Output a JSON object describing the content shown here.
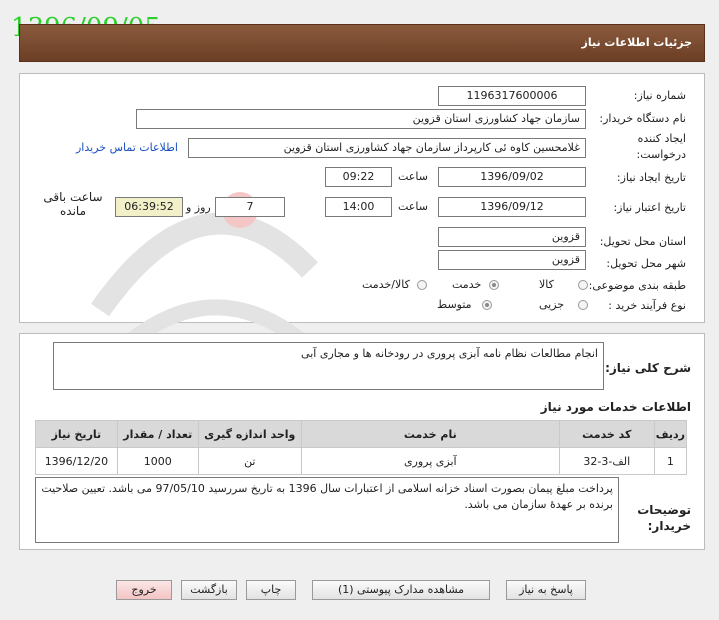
{
  "stamp_date": "1396/09/05",
  "title": "جزئیات اطلاعات نیاز",
  "form": {
    "need_number_label": "شماره نیاز:",
    "need_number": "1196317600006",
    "buyer_org_label": "نام دستگاه خریدار:",
    "buyer_org": "سازمان جهاد کشاورزی استان قزوین",
    "creator_label": "ایجاد کننده درخواست:",
    "creator": "غلامحسین کاوه ئی کارپرداز سازمان جهاد کشاورزی استان قزوین",
    "contact_link": "اطلاعات تماس خریدار",
    "created_date_label": "تاریخ ایجاد نیاز:",
    "created_date": "1396/09/02",
    "time_label": "ساعت",
    "created_time": "09:22",
    "valid_date_label": "تاریخ اعتبار نیاز:",
    "valid_date": "1396/09/12",
    "valid_time": "14:00",
    "days_value": "7",
    "days_label": "روز و",
    "remaining_time": "06:39:52",
    "remaining_label": "ساعت باقی مانده",
    "province_label": "استان محل تحویل:",
    "province": "قزوین",
    "city_label": "شهر محل تحویل:",
    "city": "قزوین",
    "category_label": "طبقه بندی موضوعی:",
    "category_options": [
      "کالا",
      "خدمت",
      "کالا/خدمت"
    ],
    "category_selected": "خدمت",
    "process_label": "نوع فرآیند خرید :",
    "process_options": [
      "جزیی",
      "متوسط"
    ],
    "process_selected": "متوسط"
  },
  "description": {
    "label": "شرح کلی نیاز:",
    "text": "انجام مطالعات نظام نامه آبزی پروری در رودخانه ها و مجاری آبی"
  },
  "services": {
    "heading": "اطلاعات خدمات مورد نیاز",
    "columns": [
      "ردیف",
      "کد خدمت",
      "نام خدمت",
      "واحد اندازه گیری",
      "تعداد / مقدار",
      "تاریخ نیاز"
    ],
    "rows": [
      [
        "1",
        "الف-3-32",
        "آبزی پروری",
        "تن",
        "1000",
        "1396/12/20"
      ]
    ]
  },
  "notes": {
    "label": "توضیحات خریدار:",
    "text": "پرداخت مبلغ پیمان بصورت اسناد خزانه اسلامی از اعتبارات سال 1396 به تاریخ سررسید 97/05/10 می باشد. تعیین صلاحیت برنده بر عهدۀ سازمان می باشد."
  },
  "buttons": {
    "reply": "پاسخ به نیاز",
    "attachments": "مشاهده مدارک پیوستی (1)",
    "print": "چاپ",
    "back": "بازگشت",
    "exit": "خروج"
  },
  "colors": {
    "title_bar": "#6b3f26",
    "stamp": "#2ccf2c",
    "exit_button": "#f3c4c4"
  }
}
